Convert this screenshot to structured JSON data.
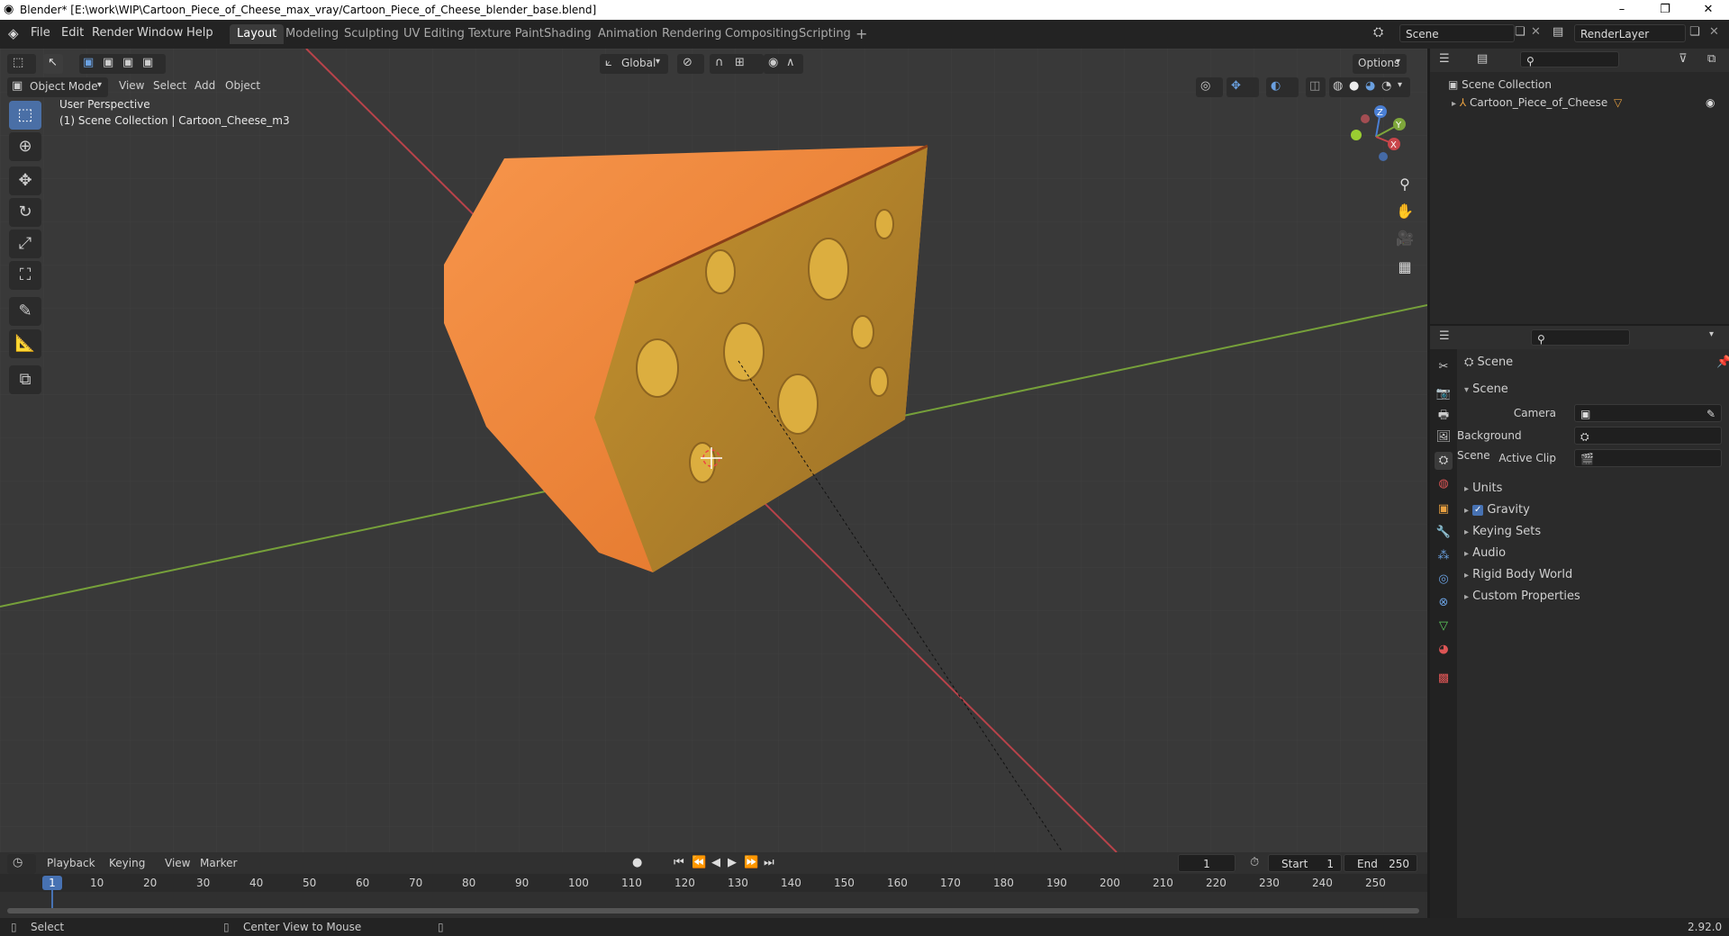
{
  "window": {
    "title": "Blender* [E:\\work\\WIP\\Cartoon_Piece_of_Cheese_max_vray/Cartoon_Piece_of_Cheese_blender_base.blend]",
    "minimize": "–",
    "maximize": "❐",
    "close": "✕"
  },
  "menubar": {
    "items": [
      "File",
      "Edit",
      "Render",
      "Window",
      "Help"
    ],
    "workspaces": [
      "Layout",
      "Modeling",
      "Sculpting",
      "UV Editing",
      "Texture Paint",
      "Shading",
      "Animation",
      "Rendering",
      "Compositing",
      "Scripting"
    ],
    "add_workspace": "+",
    "scene_name": "Scene",
    "view_layer": "RenderLayer"
  },
  "viewport": {
    "orientation": "Global",
    "options_label": "Options",
    "mode": "Object Mode",
    "menus": [
      "View",
      "Select",
      "Add",
      "Object"
    ],
    "info_line1": "User Perspective",
    "info_line2": "(1) Scene Collection | Cartoon_Cheese_m3",
    "gizmo": {
      "z": "Z",
      "y": "Y",
      "x": "X"
    }
  },
  "outliner": {
    "root": "Scene Collection",
    "object": "Cartoon_Piece_of_Cheese"
  },
  "properties": {
    "context": "Scene",
    "panel": "Scene",
    "camera_label": "Camera",
    "background_scene_label": "Background Scene",
    "active_clip_label": "Active Clip",
    "sections": [
      "Units",
      "Gravity",
      "Keying Sets",
      "Audio",
      "Rigid Body World",
      "Custom Properties"
    ]
  },
  "timeline": {
    "menus": [
      "Playback",
      "Keying",
      "View",
      "Marker"
    ],
    "current_frame": "1",
    "start_label": "Start",
    "start": "1",
    "end_label": "End",
    "end": "250",
    "ticks": [
      "10",
      "20",
      "30",
      "40",
      "50",
      "60",
      "70",
      "80",
      "90",
      "100",
      "110",
      "120",
      "130",
      "140",
      "150",
      "160",
      "170",
      "180",
      "190",
      "200",
      "210",
      "220",
      "230",
      "240",
      "250"
    ],
    "playhead": "1"
  },
  "statusbar": {
    "left": "Select",
    "middle": "Center View to Mouse",
    "version": "2.92.0"
  },
  "colors": {
    "accent": "#4772b3",
    "cheese_top": "#f28a3a",
    "cheese_face": "#b9882f",
    "x_axis": "#c8454a",
    "y_axis": "#7ea63b"
  }
}
